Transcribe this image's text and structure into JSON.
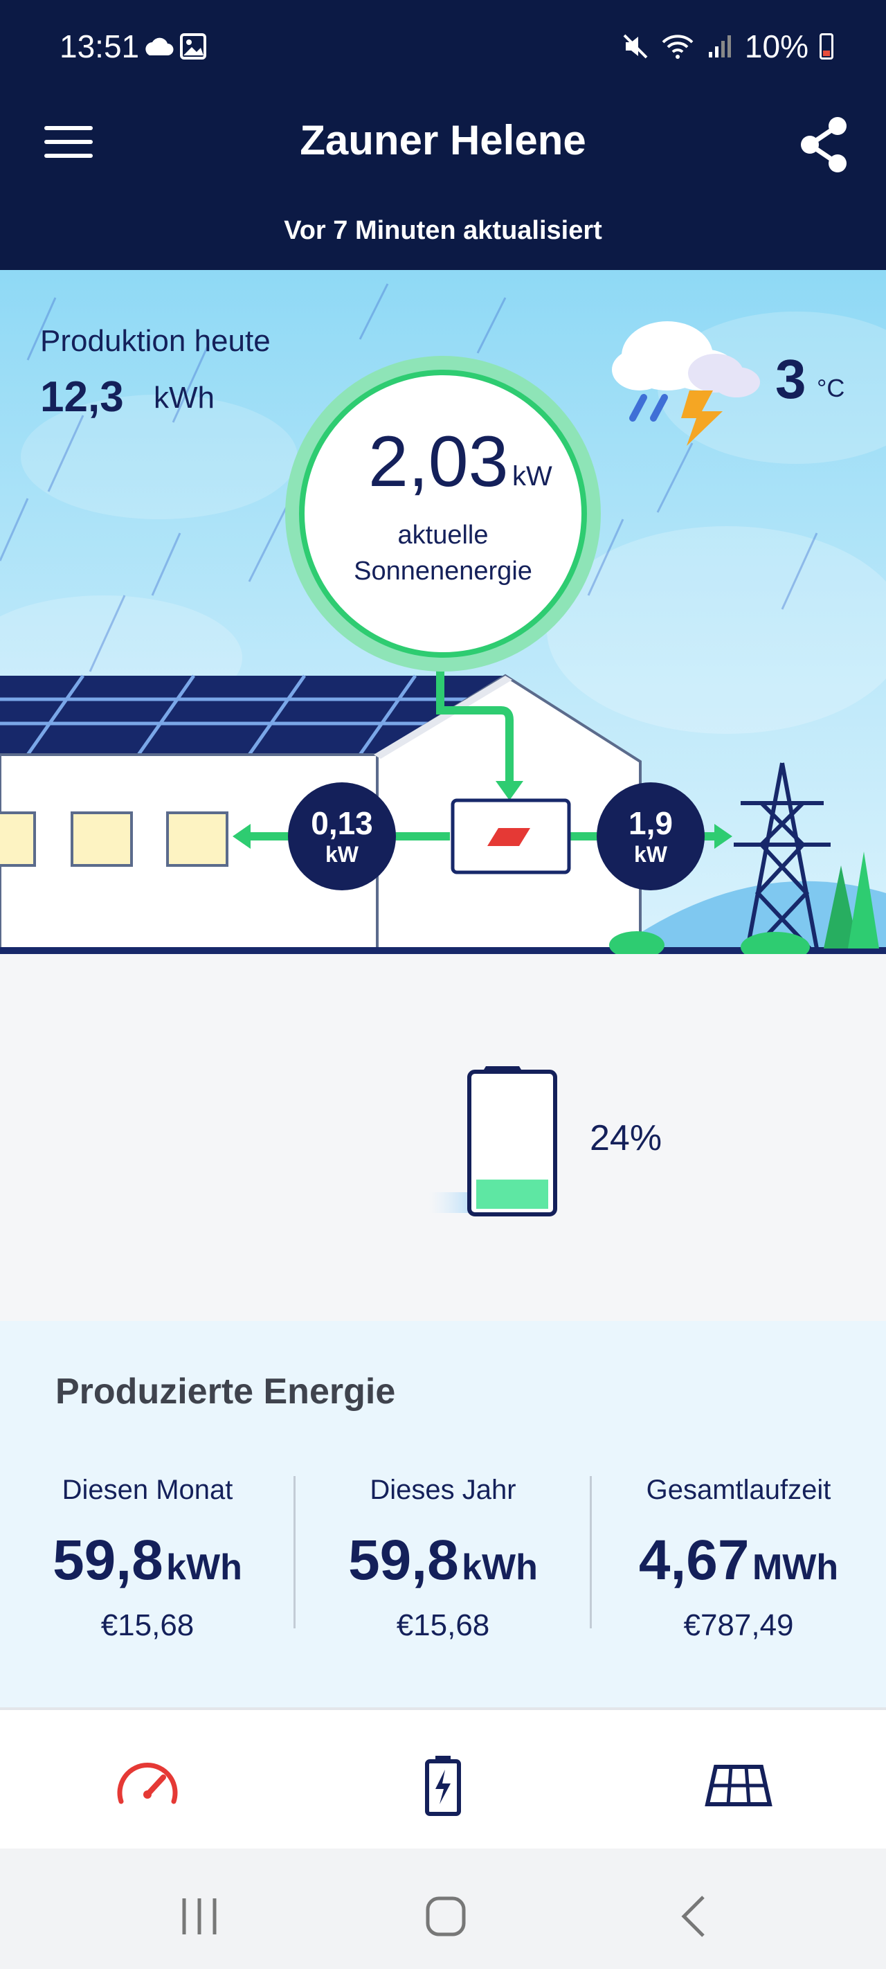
{
  "status_bar": {
    "time": "13:51",
    "battery": "10%"
  },
  "header": {
    "title": "Zauner Helene",
    "subtitle": "Vor 7 Minuten aktualisiert"
  },
  "hero": {
    "production_today_label": "Produktion heute",
    "production_today_value": "12,3",
    "production_today_unit": "kWh",
    "current_value": "2,03",
    "current_unit": "kW",
    "current_label_line1": "aktuelle",
    "current_label_line2": "Sonnenenergie",
    "temperature": "3",
    "temperature_unit": "°C",
    "house_flow_value": "0,13",
    "house_flow_unit": "kW",
    "grid_flow_value": "1,9",
    "grid_flow_unit": "kW"
  },
  "battery": {
    "percent_text": "24%",
    "level": 0.24
  },
  "energy": {
    "title": "Produzierte Energie",
    "columns": [
      {
        "label": "Diesen Monat",
        "value": "59,8",
        "unit": "kWh",
        "money": "€15,68"
      },
      {
        "label": "Dieses Jahr",
        "value": "59,8",
        "unit": "kWh",
        "money": "€15,68"
      },
      {
        "label": "Gesamtlaufzeit",
        "value": "4,67",
        "unit": "MWh",
        "money": "€787,49"
      }
    ]
  },
  "colors": {
    "navy": "#0c1a45",
    "text": "#14205a",
    "green": "#2ecc71",
    "accent_red": "#e53935"
  },
  "bottom_nav": {
    "items": [
      "gauge-icon",
      "battery-charge-icon",
      "solar-panel-icon"
    ]
  }
}
